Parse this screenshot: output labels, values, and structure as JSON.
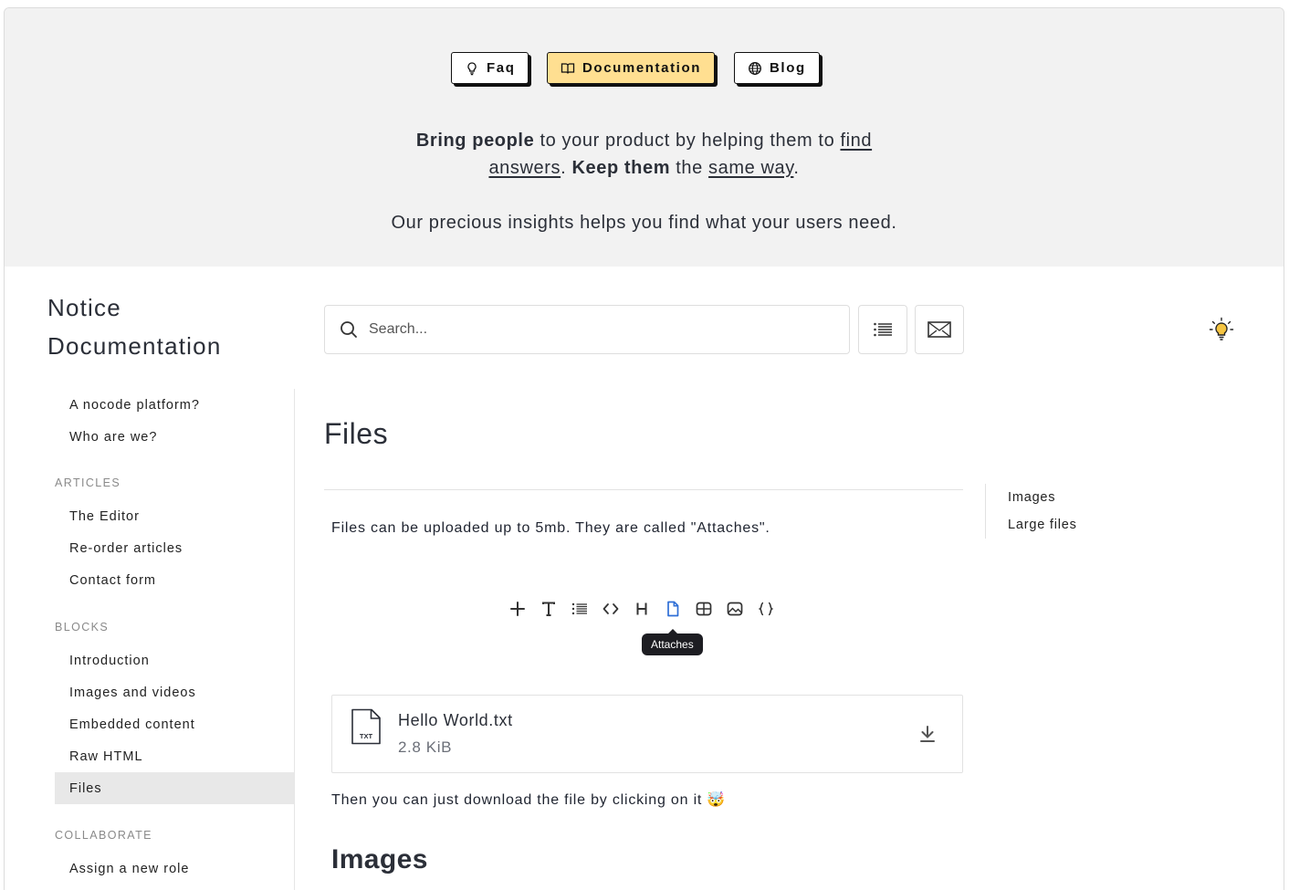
{
  "nav": {
    "faq": "Faq",
    "documentation": "Documentation",
    "blog": "Blog"
  },
  "hero": {
    "line1_bold": "Bring people",
    "line1_text": " to your product by helping them to ",
    "line1_link": "find",
    "line2_link": "answers",
    "line2_dot": ". ",
    "line2_bold": "Keep them",
    "line2_text": " the ",
    "line2_link2": "same way",
    "line2_end": ".",
    "line3": "Our precious insights helps you find what your users need."
  },
  "brand": {
    "line1": "Notice",
    "line2": "Documentation"
  },
  "search": {
    "placeholder": "Search..."
  },
  "sidebar": {
    "top_items": [
      "A nocode platform?",
      "Who are we?"
    ],
    "sections": [
      {
        "heading": "ARTICLES",
        "items": [
          "The Editor",
          "Re-order articles",
          "Contact form"
        ]
      },
      {
        "heading": "BLOCKS",
        "items": [
          "Introduction",
          "Images and videos",
          "Embedded content",
          "Raw HTML",
          "Files"
        ]
      },
      {
        "heading": "COLLABORATE",
        "items": [
          "Assign a new role"
        ]
      }
    ],
    "active_item": "Files"
  },
  "main": {
    "title": "Files",
    "intro": "Files can be uploaded up to 5mb. They are called \"Attaches\".",
    "toolbar_icons": [
      "plus-icon",
      "text-icon",
      "list-icon",
      "code-icon",
      "heading-icon",
      "attaches-icon",
      "table-icon",
      "image-icon",
      "raw-json-icon"
    ],
    "active_tool": "attaches-icon",
    "tooltip": "Attaches",
    "file": {
      "name": "Hello World.txt",
      "size": "2.8 KiB",
      "ext": "TXT"
    },
    "after_text": "Then you can just download the file by clicking on it 🤯",
    "heading_images": "Images"
  },
  "toc": {
    "items": [
      "Images",
      "Large files"
    ]
  },
  "colors": {
    "accent_yellow": "#ffdf91",
    "hero_bg": "#f2f2f2",
    "active_tool_blue": "#2f6fd6"
  }
}
